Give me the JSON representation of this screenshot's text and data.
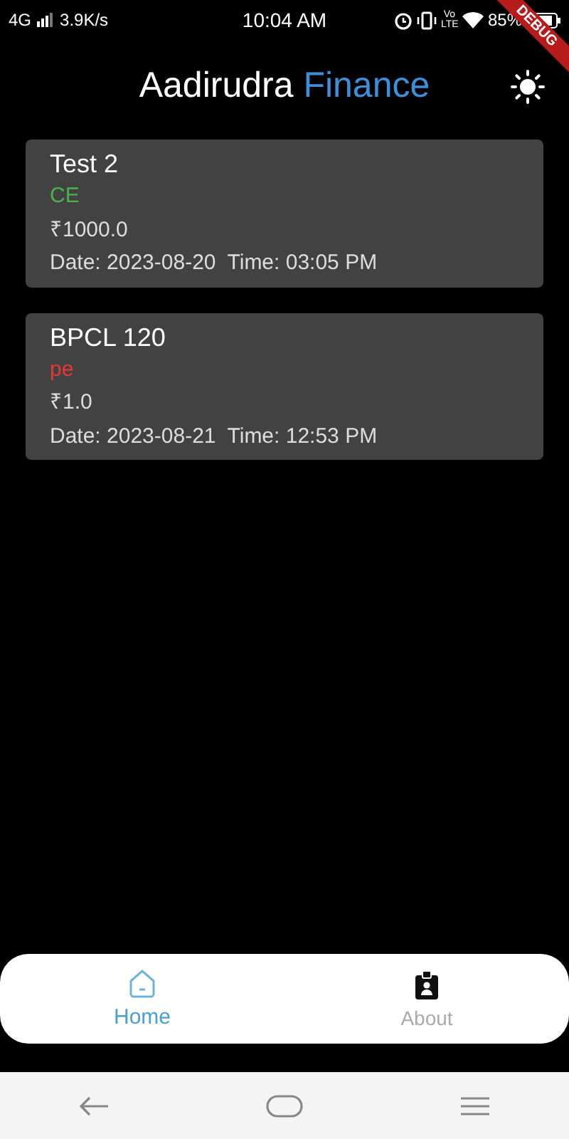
{
  "status_bar": {
    "network": "4G",
    "speed": "3.9K/s",
    "time": "10:04 AM",
    "volte": "Vo LTE",
    "battery": "85%"
  },
  "debug_banner": "DEBUG",
  "header": {
    "title_main": "Aadirudra",
    "title_accent": "Finance"
  },
  "cards": [
    {
      "name": "Test 2",
      "option": "CE",
      "color": "#4caf50",
      "amount": "₹1000.0",
      "date": "Date: 2023-08-20",
      "time": "Time: 03:05 PM"
    },
    {
      "name": "BPCL 120",
      "option": "pe",
      "color": "#e53935",
      "amount": "₹1.0",
      "date": "Date: 2023-08-21",
      "time": "Time: 12:53 PM"
    }
  ],
  "bottom_nav": [
    {
      "label": "Home",
      "kind": "home",
      "selected": true
    },
    {
      "label": "About",
      "kind": "about",
      "selected": false
    }
  ]
}
